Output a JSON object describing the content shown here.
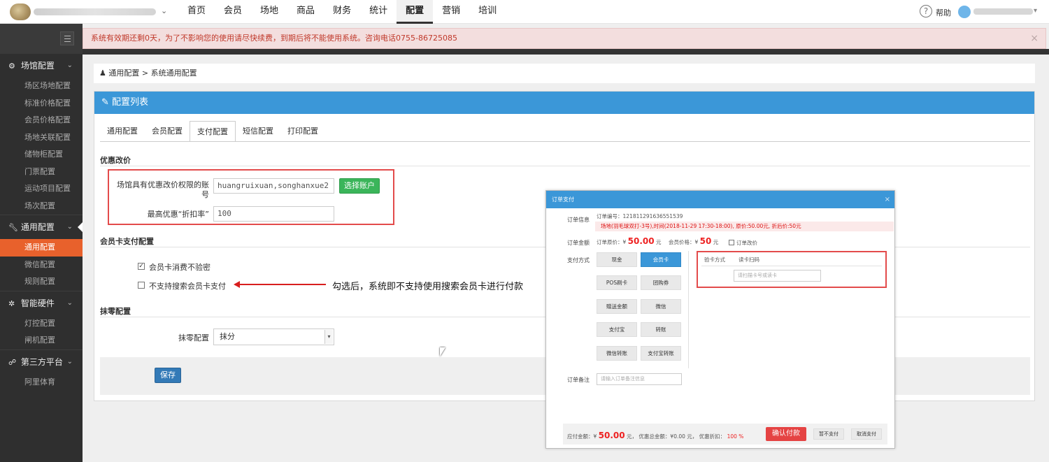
{
  "topbar": {
    "nav": [
      "首页",
      "会员",
      "场地",
      "商品",
      "财务",
      "统计",
      "配置",
      "营销",
      "培训"
    ],
    "active_nav": "配置",
    "help_label": "帮助"
  },
  "sidebar": {
    "groups": [
      {
        "title": "场馆配置",
        "icon": "gears-icon",
        "items": [
          "场区场地配置",
          "标准价格配置",
          "会员价格配置",
          "场地关联配置",
          "储物柜配置",
          "门票配置",
          "运动项目配置",
          "场次配置"
        ]
      },
      {
        "title": "通用配置",
        "icon": "wrench-icon",
        "items": [
          "通用配置",
          "微信配置",
          "规则配置"
        ],
        "active_item": "通用配置"
      },
      {
        "title": "智能硬件",
        "icon": "cog-icon",
        "items": [
          "灯控配置",
          "闸机配置"
        ]
      },
      {
        "title": "第三方平台",
        "icon": "handshake-icon",
        "items": [
          "阿里体育"
        ]
      }
    ]
  },
  "alert": {
    "text": "系统有效期还剩0天，为了不影响您的使用请尽快续费，到期后将不能使用系统。咨询电话0755-86725085",
    "close": "×"
  },
  "breadcrumb": "通用配置 > 系统通用配置",
  "panel": {
    "title": "配置列表",
    "tabs": [
      "通用配置",
      "会员配置",
      "支付配置",
      "短信配置",
      "打印配置"
    ],
    "active_tab": "支付配置",
    "discount": {
      "section": "优惠改价",
      "account_label": "场馆具有优惠改价权限的账号",
      "account_value": "huangruixuan,songhanxue2",
      "select_button": "选择账户",
      "rate_label": "最高优惠“折扣率”",
      "rate_value": "100"
    },
    "card_pay": {
      "section": "会员卡支付配置",
      "opt1": "会员卡消费不验密",
      "opt1_checked": true,
      "opt2": "不支持搜索会员卡支付",
      "opt2_checked": false,
      "annotation": "勾选后，系统即不支持使用搜索会员卡进行付款"
    },
    "rounding": {
      "section": "抹零配置",
      "label": "抹零配置",
      "value": "抹分"
    },
    "save_label": "保存"
  },
  "modal": {
    "title": "订单支付",
    "close": "×",
    "order_info_label": "订单信息",
    "order_no": "订单编号：121811291636551539",
    "order_detail": "场地(羽毛球双打-3号),时间(2018-11-29 17:30-18:00), 原价:50.00元, 折后价:50元",
    "amount_label": "订单金额",
    "orig_price_prefix": "订单原价：¥",
    "orig_price": "50.00",
    "orig_price_unit": "元",
    "member_price_prefix": "会员价格：¥",
    "member_price": "50",
    "member_price_unit": "元",
    "change_price": "订单改价",
    "pay_method_label": "支付方式",
    "pay_methods": [
      "现金",
      "会员卡",
      "POS刷卡",
      "团购券",
      "赠送金额",
      "微信",
      "支付宝",
      "转账",
      "微信转账",
      "支付宝转账"
    ],
    "active_pay": "会员卡",
    "verify_label": "验卡方式",
    "verify_value": "读卡扫码",
    "card_placeholder": "请扫描卡号或读卡",
    "remark_label": "订单备注",
    "remark_placeholder": "请输入订单备注信息",
    "payable_label": "应付金额：¥",
    "payable": "50.00",
    "payable_unit": "元，",
    "discount_total": "优惠总金额：¥0.00 元，",
    "discount_rate_label": "优惠折扣：",
    "discount_rate": "100 %",
    "confirm": "确认付款",
    "hold": "暂不支付",
    "cancel": "取消支付"
  }
}
